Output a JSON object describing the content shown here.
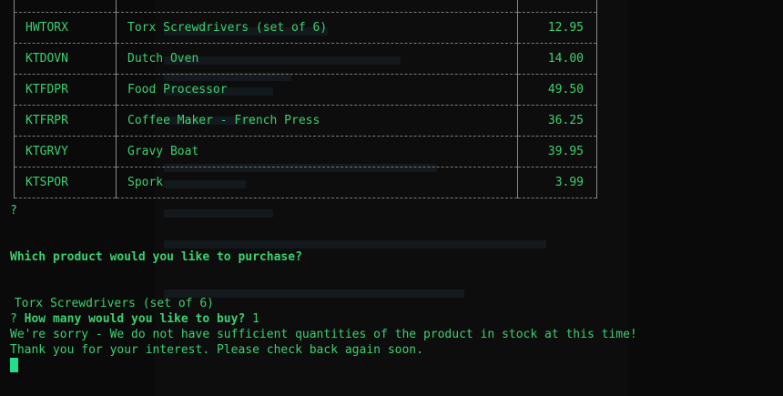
{
  "products": [
    {
      "id": "",
      "name": "",
      "price": ""
    },
    {
      "id": "HWTORX",
      "name": "Torx Screwdrivers (set of 6)",
      "price": "12.95"
    },
    {
      "id": "KTDOVN",
      "name": "Dutch Oven",
      "price": "14.00"
    },
    {
      "id": "KTFDPR",
      "name": "Food Processor",
      "price": "49.50"
    },
    {
      "id": "KTFRPR",
      "name": "Coffee Maker - French Press",
      "price": "36.25"
    },
    {
      "id": "KTGRVY",
      "name": "Gravy Boat",
      "price": "39.95"
    },
    {
      "id": "KTSPOR",
      "name": "Spork",
      "price": "3.99"
    }
  ],
  "terminal": {
    "question_mark_1": "?",
    "purchase_question": "Which product would you like to purchase?",
    "selected_product": " Torx Screwdrivers (set of 6)",
    "question_mark_2": "?",
    "quantity_question": "How many would you like to buy?",
    "quantity_answer": "1",
    "sorry_message": "We're sorry - We do not have sufficient quantities of the product in stock at this time!",
    "thanks_message": "Thank you for your interest. Please check back again soon."
  },
  "colors": {
    "text": "#3bd16f",
    "background": "#0a0a0a",
    "cursor": "#22e08a",
    "table_border": "#8a8a8a"
  }
}
